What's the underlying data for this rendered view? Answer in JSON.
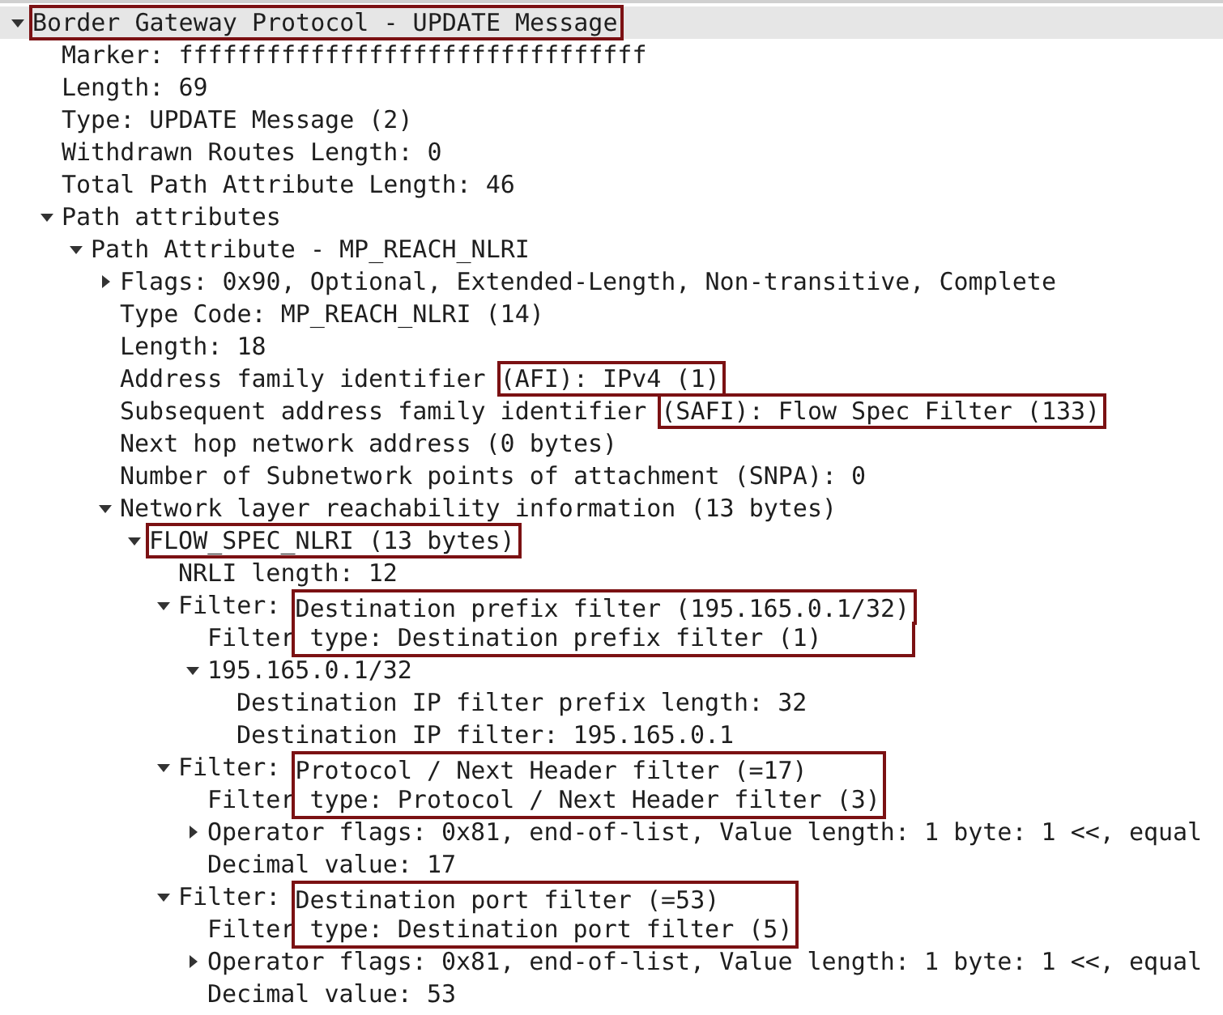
{
  "tree": [
    {
      "boxed": "Border Gateway Protocol - UPDATE Message",
      "kind": "box",
      "selected": true,
      "expanded": true,
      "children": [
        {
          "text": "Marker: ffffffffffffffffffffffffffffffff",
          "selected": false
        },
        {
          "text": "Length: 69",
          "selected": false
        },
        {
          "text": "Type: UPDATE Message (2)",
          "selected": false
        },
        {
          "text": "Withdrawn Routes Length: 0",
          "selected": false
        },
        {
          "text": "Total Path Attribute Length: 46",
          "selected": false
        },
        {
          "text": "Path attributes",
          "selected": false,
          "expanded": true,
          "children": [
            {
              "text": "Path Attribute - MP_REACH_NLRI",
              "selected": false,
              "expanded": true,
              "children": [
                {
                  "text": "Flags: 0x90, Optional, Extended-Length, Non-transitive, Complete",
                  "selected": false,
                  "expanded": false
                },
                {
                  "text": "Type Code: MP_REACH_NLRI (14)",
                  "selected": false
                },
                {
                  "text": "Length: 18",
                  "selected": false
                },
                {
                  "text": "Address family identifier ",
                  "boxed": "(AFI): IPv4 (1)",
                  "kind": "box",
                  "selected": false
                },
                {
                  "text": "Subsequent address family identifier ",
                  "boxed": "(SAFI): Flow Spec Filter (133)",
                  "kind": "box",
                  "selected": false
                },
                {
                  "text": "Next hop network address (0 bytes)",
                  "selected": false
                },
                {
                  "text": "Number of Subnetwork points of attachment (SNPA): 0",
                  "selected": false
                },
                {
                  "text": "Network layer reachability information (13 bytes)",
                  "selected": false,
                  "expanded": true,
                  "children": [
                    {
                      "boxed": "FLOW_SPEC_NLRI (13 bytes)",
                      "kind": "box",
                      "selected": false,
                      "expanded": true,
                      "children": [
                        {
                          "text": "NRLI length: 12",
                          "selected": false
                        },
                        {
                          "text": "Filter: ",
                          "boxed": "Destination prefix filter (195.165.0.1/32)",
                          "kind": "box-top",
                          "selected": false,
                          "expanded": true,
                          "children": [
                            {
                              "text": "Filter",
                              "boxed": " type: Destination prefix filter (1)",
                              "kind": "box-bottom",
                              "selected": false
                            },
                            {
                              "text": "195.165.0.1/32",
                              "selected": false,
                              "expanded": true,
                              "children": [
                                {
                                  "text": "Destination IP filter prefix length: 32",
                                  "selected": false
                                },
                                {
                                  "text": "Destination IP filter: 195.165.0.1",
                                  "selected": false
                                }
                              ]
                            }
                          ]
                        },
                        {
                          "text": "Filter: ",
                          "boxed": "Protocol / Next Header filter (=17)",
                          "kind": "box-top",
                          "selected": false,
                          "expanded": true,
                          "children": [
                            {
                              "text": "Filter",
                              "boxed": " type: Protocol / Next Header filter (3)",
                              "kind": "box-bottom",
                              "selected": false
                            },
                            {
                              "text": "Operator flags: 0x81, end-of-list, Value length: 1 byte: 1 <<, equal",
                              "selected": false,
                              "expanded": false
                            },
                            {
                              "text": "Decimal value: 17",
                              "selected": false
                            }
                          ]
                        },
                        {
                          "text": "Filter: ",
                          "boxed": "Destination port filter (=53)",
                          "kind": "box-top",
                          "selected": false,
                          "expanded": true,
                          "children": [
                            {
                              "text": "Filter",
                              "boxed": " type: Destination port filter (5)",
                              "kind": "box-bottom",
                              "selected": false
                            },
                            {
                              "text": "Operator flags: 0x81, end-of-list, Value length: 1 byte: 1 <<, equal",
                              "selected": false,
                              "expanded": false
                            },
                            {
                              "text": "Decimal value: 53",
                              "selected": false
                            }
                          ]
                        }
                      ]
                    }
                  ]
                }
              ]
            }
          ]
        }
      ]
    }
  ]
}
